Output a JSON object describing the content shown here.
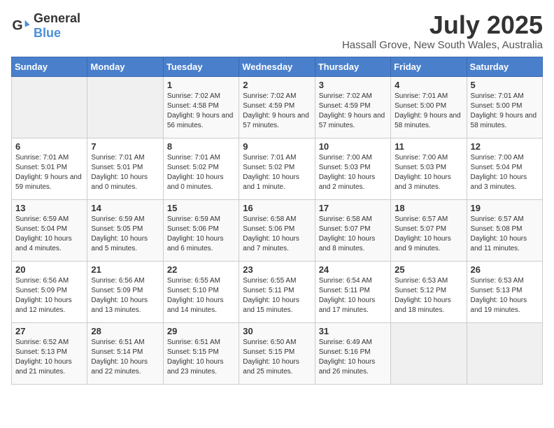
{
  "header": {
    "logo_general": "General",
    "logo_blue": "Blue",
    "month": "July 2025",
    "location": "Hassall Grove, New South Wales, Australia"
  },
  "weekdays": [
    "Sunday",
    "Monday",
    "Tuesday",
    "Wednesday",
    "Thursday",
    "Friday",
    "Saturday"
  ],
  "weeks": [
    [
      {
        "day": "",
        "info": ""
      },
      {
        "day": "",
        "info": ""
      },
      {
        "day": "1",
        "info": "Sunrise: 7:02 AM\nSunset: 4:58 PM\nDaylight: 9 hours and 56 minutes."
      },
      {
        "day": "2",
        "info": "Sunrise: 7:02 AM\nSunset: 4:59 PM\nDaylight: 9 hours and 57 minutes."
      },
      {
        "day": "3",
        "info": "Sunrise: 7:02 AM\nSunset: 4:59 PM\nDaylight: 9 hours and 57 minutes."
      },
      {
        "day": "4",
        "info": "Sunrise: 7:01 AM\nSunset: 5:00 PM\nDaylight: 9 hours and 58 minutes."
      },
      {
        "day": "5",
        "info": "Sunrise: 7:01 AM\nSunset: 5:00 PM\nDaylight: 9 hours and 58 minutes."
      }
    ],
    [
      {
        "day": "6",
        "info": "Sunrise: 7:01 AM\nSunset: 5:01 PM\nDaylight: 9 hours and 59 minutes."
      },
      {
        "day": "7",
        "info": "Sunrise: 7:01 AM\nSunset: 5:01 PM\nDaylight: 10 hours and 0 minutes."
      },
      {
        "day": "8",
        "info": "Sunrise: 7:01 AM\nSunset: 5:02 PM\nDaylight: 10 hours and 0 minutes."
      },
      {
        "day": "9",
        "info": "Sunrise: 7:01 AM\nSunset: 5:02 PM\nDaylight: 10 hours and 1 minute."
      },
      {
        "day": "10",
        "info": "Sunrise: 7:00 AM\nSunset: 5:03 PM\nDaylight: 10 hours and 2 minutes."
      },
      {
        "day": "11",
        "info": "Sunrise: 7:00 AM\nSunset: 5:03 PM\nDaylight: 10 hours and 3 minutes."
      },
      {
        "day": "12",
        "info": "Sunrise: 7:00 AM\nSunset: 5:04 PM\nDaylight: 10 hours and 3 minutes."
      }
    ],
    [
      {
        "day": "13",
        "info": "Sunrise: 6:59 AM\nSunset: 5:04 PM\nDaylight: 10 hours and 4 minutes."
      },
      {
        "day": "14",
        "info": "Sunrise: 6:59 AM\nSunset: 5:05 PM\nDaylight: 10 hours and 5 minutes."
      },
      {
        "day": "15",
        "info": "Sunrise: 6:59 AM\nSunset: 5:06 PM\nDaylight: 10 hours and 6 minutes."
      },
      {
        "day": "16",
        "info": "Sunrise: 6:58 AM\nSunset: 5:06 PM\nDaylight: 10 hours and 7 minutes."
      },
      {
        "day": "17",
        "info": "Sunrise: 6:58 AM\nSunset: 5:07 PM\nDaylight: 10 hours and 8 minutes."
      },
      {
        "day": "18",
        "info": "Sunrise: 6:57 AM\nSunset: 5:07 PM\nDaylight: 10 hours and 9 minutes."
      },
      {
        "day": "19",
        "info": "Sunrise: 6:57 AM\nSunset: 5:08 PM\nDaylight: 10 hours and 11 minutes."
      }
    ],
    [
      {
        "day": "20",
        "info": "Sunrise: 6:56 AM\nSunset: 5:09 PM\nDaylight: 10 hours and 12 minutes."
      },
      {
        "day": "21",
        "info": "Sunrise: 6:56 AM\nSunset: 5:09 PM\nDaylight: 10 hours and 13 minutes."
      },
      {
        "day": "22",
        "info": "Sunrise: 6:55 AM\nSunset: 5:10 PM\nDaylight: 10 hours and 14 minutes."
      },
      {
        "day": "23",
        "info": "Sunrise: 6:55 AM\nSunset: 5:11 PM\nDaylight: 10 hours and 15 minutes."
      },
      {
        "day": "24",
        "info": "Sunrise: 6:54 AM\nSunset: 5:11 PM\nDaylight: 10 hours and 17 minutes."
      },
      {
        "day": "25",
        "info": "Sunrise: 6:53 AM\nSunset: 5:12 PM\nDaylight: 10 hours and 18 minutes."
      },
      {
        "day": "26",
        "info": "Sunrise: 6:53 AM\nSunset: 5:13 PM\nDaylight: 10 hours and 19 minutes."
      }
    ],
    [
      {
        "day": "27",
        "info": "Sunrise: 6:52 AM\nSunset: 5:13 PM\nDaylight: 10 hours and 21 minutes."
      },
      {
        "day": "28",
        "info": "Sunrise: 6:51 AM\nSunset: 5:14 PM\nDaylight: 10 hours and 22 minutes."
      },
      {
        "day": "29",
        "info": "Sunrise: 6:51 AM\nSunset: 5:15 PM\nDaylight: 10 hours and 23 minutes."
      },
      {
        "day": "30",
        "info": "Sunrise: 6:50 AM\nSunset: 5:15 PM\nDaylight: 10 hours and 25 minutes."
      },
      {
        "day": "31",
        "info": "Sunrise: 6:49 AM\nSunset: 5:16 PM\nDaylight: 10 hours and 26 minutes."
      },
      {
        "day": "",
        "info": ""
      },
      {
        "day": "",
        "info": ""
      }
    ]
  ]
}
